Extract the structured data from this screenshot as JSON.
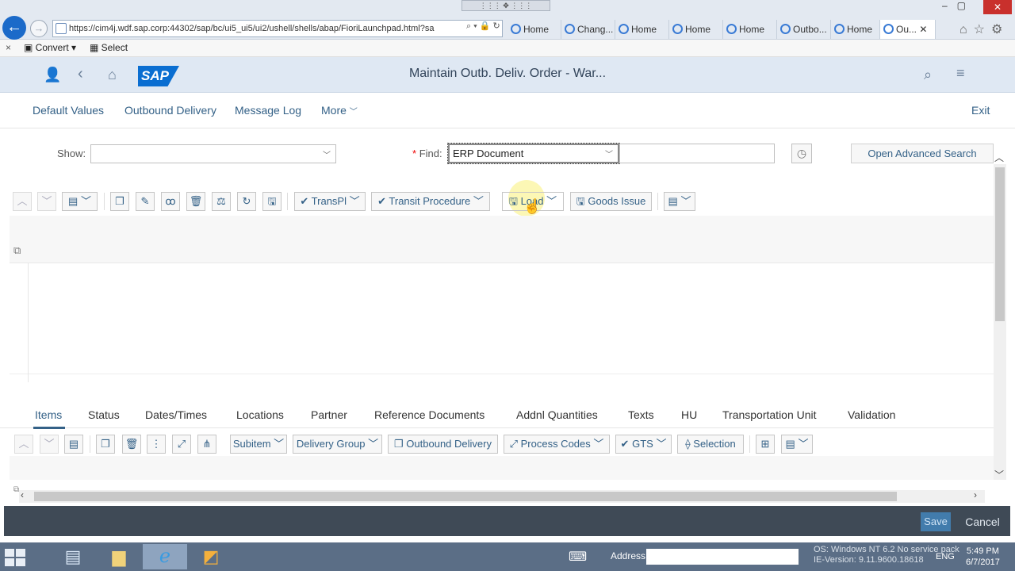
{
  "browser": {
    "url": "https://cim4j.wdf.sap.corp:44302/sap/bc/ui5_ui5/ui2/ushell/shells/abap/FioriLaunchpad.html?sa",
    "url_host_bold": "sap.corp",
    "tabs": [
      "Home",
      "Chang...",
      "Home",
      "Home",
      "Home",
      "Outbo...",
      "Home",
      "Ou..."
    ],
    "active_tab_index": 7,
    "command_bar": {
      "close": "×",
      "convert": "Convert",
      "select": "Select"
    }
  },
  "shell": {
    "title": "Maintain Outb. Deliv. Order - War...",
    "logo": "SAP"
  },
  "subheader": {
    "links": [
      "Default Values",
      "Outbound Delivery",
      "Message Log",
      "More"
    ],
    "exit": "Exit"
  },
  "findbar": {
    "show_label": "Show:",
    "show_value": "",
    "find_required_mark": "*",
    "find_label": "Find:",
    "find_value": "ERP Document",
    "find_input_value": "",
    "advanced_search": "Open Advanced Search"
  },
  "toolbar": {
    "transpl": "TransPl",
    "transit_procedure": "Transit Procedure",
    "load": "Load",
    "goods_issue": "Goods Issue"
  },
  "item_tabs": [
    "Items",
    "Status",
    "Dates/Times",
    "Locations",
    "Partner",
    "Reference Documents",
    "Addnl Quantities",
    "Texts",
    "HU",
    "Transportation Unit",
    "Validation"
  ],
  "selected_item_tab": "Items",
  "item_toolbar": {
    "subitem": "Subitem",
    "delivery_group": "Delivery Group",
    "outbound_delivery": "Outbound Delivery",
    "process_codes": "Process Codes",
    "gts": "GTS",
    "selection": "Selection"
  },
  "footer": {
    "save": "Save",
    "cancel": "Cancel"
  },
  "taskbar": {
    "address_label": "Address",
    "os_line1": "OS: Windows NT 6.2 No service pack",
    "os_line2": "IE-Version: 9.11.9600.18618",
    "lang": "ENG",
    "time": "5:49 PM",
    "date": "6/7/2017"
  },
  "colors": {
    "accent": "#346187",
    "shell": "#dfe8f3",
    "footer": "#3f4a56",
    "save": "#427cac"
  }
}
